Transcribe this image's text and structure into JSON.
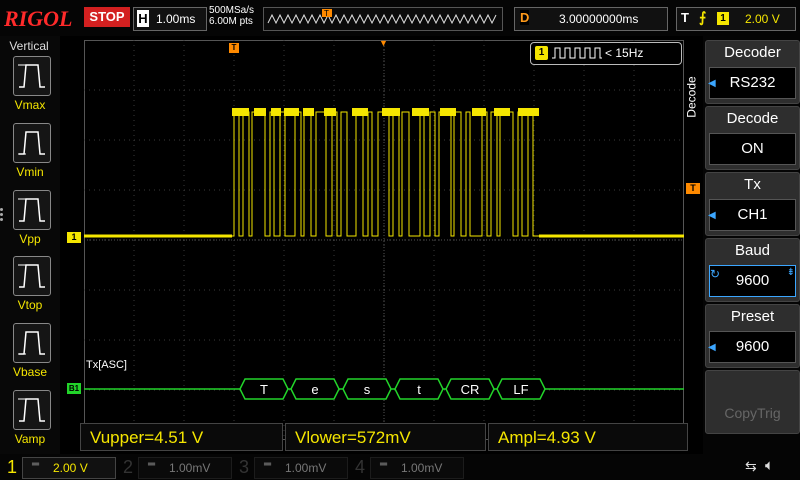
{
  "topbar": {
    "brand": "RIGOL",
    "run_state": "STOP",
    "horizontal_label": "H",
    "timebase": "1.00ms",
    "sample_rate": "500MSa/s",
    "memory_depth": "6.00M pts",
    "delay_label": "D",
    "delay_value": "3.00000000ms",
    "trigger_label": "T",
    "trigger_source": "1",
    "trigger_level": "2.00 V"
  },
  "left_panel": {
    "title": "Vertical",
    "items": [
      {
        "label": "Vmax",
        "icon": "vmax-icon"
      },
      {
        "label": "Vmin",
        "icon": "vmin-icon"
      },
      {
        "label": "Vpp",
        "icon": "vpp-icon"
      },
      {
        "label": "Vtop",
        "icon": "vtop-icon"
      },
      {
        "label": "Vbase",
        "icon": "vbase-icon"
      },
      {
        "label": "Vamp",
        "icon": "vamp-icon"
      }
    ]
  },
  "display": {
    "trigger_marker": "T",
    "channel_marker": "1",
    "decoder_marker": "B1",
    "counter_channel": "1",
    "counter_value": "< 15Hz",
    "bus_label": "Tx[ASC]",
    "decoded_frames": [
      "T",
      "e",
      "s",
      "t",
      "CR",
      "LF"
    ],
    "trigger_level_marker": "T",
    "colors": {
      "ch1": "#f5e600",
      "decode": "#22d42a",
      "trigger": "#ff8a00",
      "grid": "#3a3a3a"
    }
  },
  "menu": {
    "side_title": "Decode",
    "items": [
      {
        "title": "Decoder",
        "value": "RS232"
      },
      {
        "title": "Decode",
        "value": "ON"
      },
      {
        "title": "Tx",
        "value": "CH1"
      },
      {
        "title": "Baud",
        "value": "9600"
      },
      {
        "title": "Preset",
        "value": "9600"
      },
      {
        "title": "",
        "value": "CopyTrig"
      }
    ]
  },
  "measurements": [
    {
      "text": "Vupper=4.51 V"
    },
    {
      "text": "Vlower=572mV"
    },
    {
      "text": "Ampl=4.93 V"
    }
  ],
  "channels": [
    {
      "num": "1",
      "value": "2.00 V",
      "color": "#f5e600",
      "active": true
    },
    {
      "num": "2",
      "value": "1.00mV",
      "color": "#2bb8c8",
      "active": false
    },
    {
      "num": "3",
      "value": "1.00mV",
      "color": "#c828c8",
      "active": false
    },
    {
      "num": "4",
      "value": "1.00mV",
      "color": "#3070ff",
      "active": false
    }
  ]
}
